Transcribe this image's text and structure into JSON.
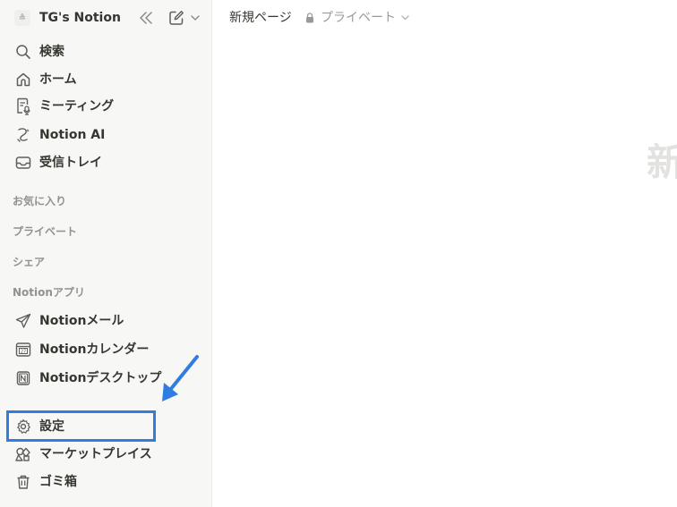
{
  "sidebar": {
    "workspace": {
      "avatar_glyph": "≗",
      "name": "TG's Notion",
      "collapse_icon": "double-chevron-left-icon",
      "new_page_icon": "compose-icon",
      "menu_icon": "chevron-down-icon"
    },
    "nav": [
      {
        "label": "検索",
        "icon": "search-icon"
      },
      {
        "label": "ホーム",
        "icon": "home-icon"
      },
      {
        "label": "ミーティング",
        "icon": "meeting-notes-icon"
      },
      {
        "label": "Notion AI",
        "icon": "notion-ai-icon"
      },
      {
        "label": "受信トレイ",
        "icon": "inbox-icon"
      }
    ],
    "sections": {
      "favorites": "お気に入り",
      "private": "プライベート",
      "shared": "シェア",
      "apps": "Notionアプリ"
    },
    "apps": [
      {
        "label": "Notionメール",
        "icon": "mail-send-icon"
      },
      {
        "label": "Notionカレンダー",
        "icon": "calendar-icon"
      },
      {
        "label": "Notionデスクトップ",
        "icon": "notion-logo-icon"
      }
    ],
    "footer": [
      {
        "label": "設定",
        "icon": "gear-icon"
      },
      {
        "label": "マーケットプレイス",
        "icon": "marketplace-icon"
      },
      {
        "label": "ゴミ箱",
        "icon": "trash-icon"
      }
    ]
  },
  "topbar": {
    "page_title": "新規ページ",
    "privacy_label": "プライベート",
    "privacy_icon": "lock-icon"
  },
  "main": {
    "title_fragment": "新"
  },
  "annotation": {
    "highlight_color": "#2f7de1",
    "arrow_color": "#2f7de1"
  }
}
